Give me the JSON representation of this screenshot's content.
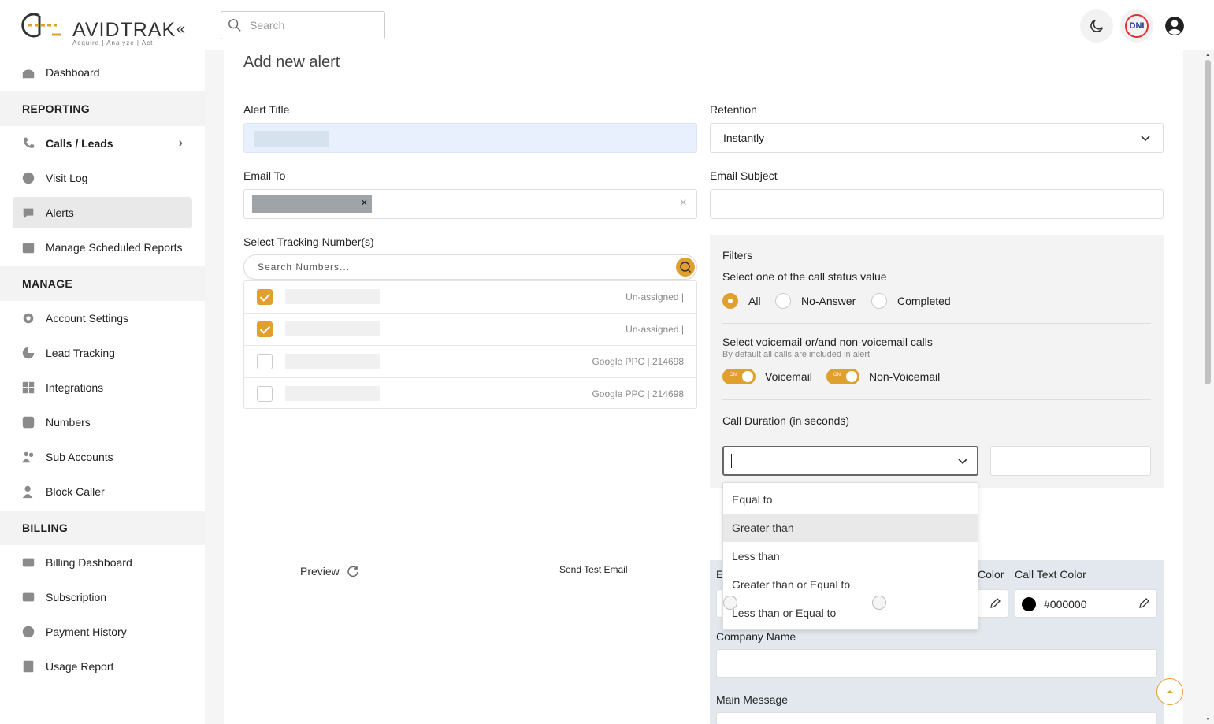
{
  "brand": {
    "name_pre": "AVIDTRAK",
    "tagline": "Acquire  |  Analyze  |  Act",
    "accent": "#e0a030"
  },
  "sidebar": {
    "items": [
      {
        "label": "Dashboard",
        "icon": "home-icon"
      },
      {
        "section": "REPORTING"
      },
      {
        "label": "Calls / Leads",
        "icon": "phone-icon"
      },
      {
        "label": "Visit Log",
        "icon": "globe-icon"
      },
      {
        "label": "Alerts",
        "icon": "bell-icon"
      },
      {
        "label": "Manage Scheduled Reports",
        "icon": "calendar-icon"
      },
      {
        "section": "MANAGE"
      },
      {
        "label": "Account Settings",
        "icon": "gear-icon"
      },
      {
        "label": "Lead Tracking",
        "icon": "pie-chart-icon"
      },
      {
        "label": "Integrations",
        "icon": "grid-icon"
      },
      {
        "label": "Numbers",
        "icon": "hash-icon"
      },
      {
        "label": "Sub Accounts",
        "icon": "users-icon"
      },
      {
        "label": "Block Caller",
        "icon": "user-block-icon"
      },
      {
        "section": "BILLING"
      },
      {
        "label": "Billing Dashboard",
        "icon": "card-icon"
      },
      {
        "label": "Subscription",
        "icon": "subscription-icon"
      },
      {
        "label": "Payment History",
        "icon": "dollar-icon"
      },
      {
        "label": "Usage Report",
        "icon": "report-icon"
      }
    ]
  },
  "topbar": {
    "search_placeholder": "Search",
    "dni_label": "DNI"
  },
  "form": {
    "page_title": "Add new alert",
    "alert_title_label": "Alert Title",
    "retention_label": "Retention",
    "retention_value": "Instantly",
    "email_to_label": "Email To",
    "email_subject_label": "Email Subject",
    "tracking_label": "Select Tracking Number(s)",
    "numbers_search_placeholder": "Search Numbers...",
    "numbers": [
      {
        "checked": true,
        "source": "Un-assigned |"
      },
      {
        "checked": true,
        "source": "Un-assigned |"
      },
      {
        "checked": false,
        "source": "Google PPC | 214698"
      },
      {
        "checked": false,
        "source": "Google PPC | 214698"
      }
    ]
  },
  "filters": {
    "title": "Filters",
    "status_label": "Select one of the call status value",
    "status_options": [
      "All",
      "No-Answer",
      "Completed"
    ],
    "status_selected": "All",
    "voicemail_label": "Select voicemail or/and non-voicemail calls",
    "voicemail_sub": "By default all calls are included in alert",
    "toggle_on_text": "ON",
    "voicemail": "Voicemail",
    "non_voicemail": "Non-Voicemail",
    "duration_label": "Call Duration (in seconds)",
    "duration_options": [
      "Equal to",
      "Greater than",
      "Less than",
      "Greater than or Equal to",
      "Less than or Equal to"
    ],
    "duration_highlighted": "Greater than"
  },
  "bottom": {
    "preview_label": "Preview",
    "send_test_label": "Send Test Email",
    "email_partial_label": "E",
    "color_partial_label": "Color",
    "call_text_color_label": "Call Text Color",
    "call_text_color_value": "#000000",
    "company_name_label": "Company Name",
    "main_message_label": "Main Message"
  }
}
